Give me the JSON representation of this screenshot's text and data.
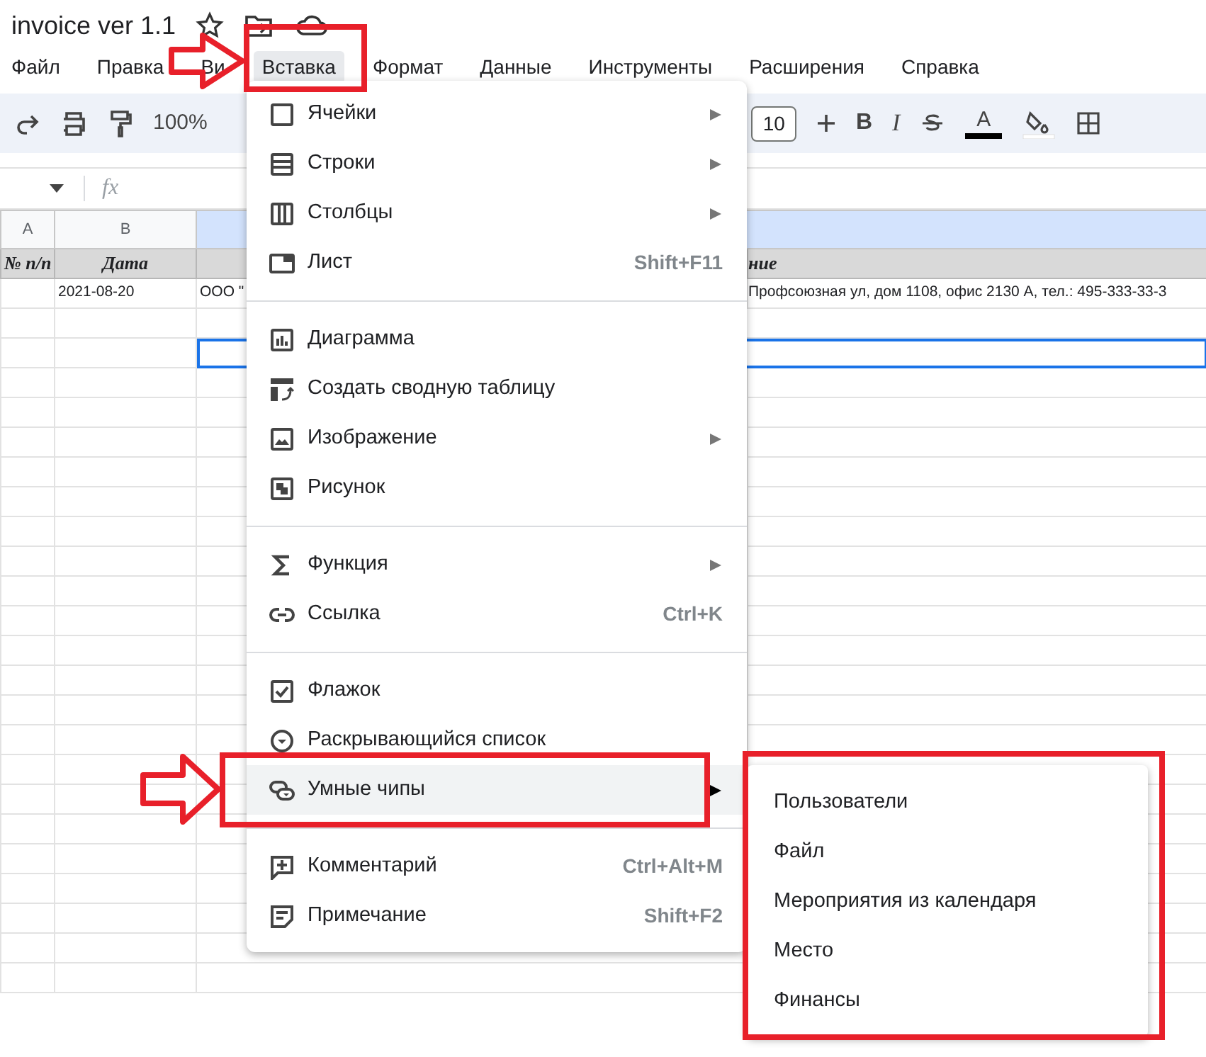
{
  "document": {
    "title": "invoice ver 1.1"
  },
  "menu_bar": [
    {
      "label": "Файл",
      "selected": false
    },
    {
      "label": "Правка",
      "selected": false
    },
    {
      "label": "Ви",
      "selected": false
    },
    {
      "label": "Вставка",
      "selected": true
    },
    {
      "label": "Формат",
      "selected": false
    },
    {
      "label": "Данные",
      "selected": false
    },
    {
      "label": "Инструменты",
      "selected": false
    },
    {
      "label": "Расширения",
      "selected": false
    },
    {
      "label": "Справка",
      "selected": false
    }
  ],
  "toolbar": {
    "zoom": "100%",
    "font_size": "10",
    "bold": "B",
    "italic": "I",
    "text_color": "A"
  },
  "formula_bar": {
    "fx": "fx"
  },
  "columns": [
    {
      "label": "A",
      "selected": false
    },
    {
      "label": "B",
      "selected": false
    },
    {
      "selected": true
    }
  ],
  "rows": [
    {
      "kind": "header",
      "cells": [
        "№ п/п",
        "Дата",
        "",
        "ние"
      ]
    },
    {
      "kind": "data",
      "cells": [
        "",
        "2021-08-20",
        "ООО \"",
        "Профсоюзная ул, дом 1108, офис 2130 А, тел.: 495-333-33-3"
      ]
    },
    {
      "kind": "empty",
      "selected": false
    },
    {
      "kind": "empty",
      "selected": true
    }
  ],
  "insert_menu": [
    [
      {
        "label": "Ячейки",
        "submenu": true,
        "selected": false
      },
      {
        "label": "Строки",
        "submenu": true,
        "selected": false
      },
      {
        "label": "Столбцы",
        "submenu": true,
        "selected": false
      },
      {
        "label": "Лист",
        "shortcut": "Shift+F11",
        "submenu": false,
        "selected": false
      }
    ],
    [
      {
        "label": "Диаграмма",
        "submenu": false,
        "selected": false
      },
      {
        "label": "Создать сводную таблицу",
        "submenu": false,
        "selected": false
      },
      {
        "label": "Изображение",
        "submenu": true,
        "selected": false
      },
      {
        "label": "Рисунок",
        "submenu": false,
        "selected": false
      }
    ],
    [
      {
        "label": "Функция",
        "submenu": true,
        "selected": false
      },
      {
        "label": "Ссылка",
        "shortcut": "Ctrl+K",
        "submenu": false,
        "selected": false
      }
    ],
    [
      {
        "label": "Флажок",
        "submenu": false,
        "selected": false
      },
      {
        "label": "Раскрывающийся список",
        "submenu": false,
        "selected": false
      },
      {
        "label": "Умные чипы",
        "submenu": true,
        "selected": true
      }
    ],
    [
      {
        "label": "Комментарий",
        "shortcut": "Ctrl+Alt+M",
        "submenu": false,
        "selected": false
      },
      {
        "label": "Примечание",
        "shortcut": "Shift+F2",
        "submenu": false,
        "selected": false
      }
    ]
  ],
  "smart_chips_submenu": [
    {
      "label": "Пользователи"
    },
    {
      "label": "Файл"
    },
    {
      "label": "Мероприятия из календаря"
    },
    {
      "label": "Место"
    },
    {
      "label": "Финансы"
    }
  ]
}
